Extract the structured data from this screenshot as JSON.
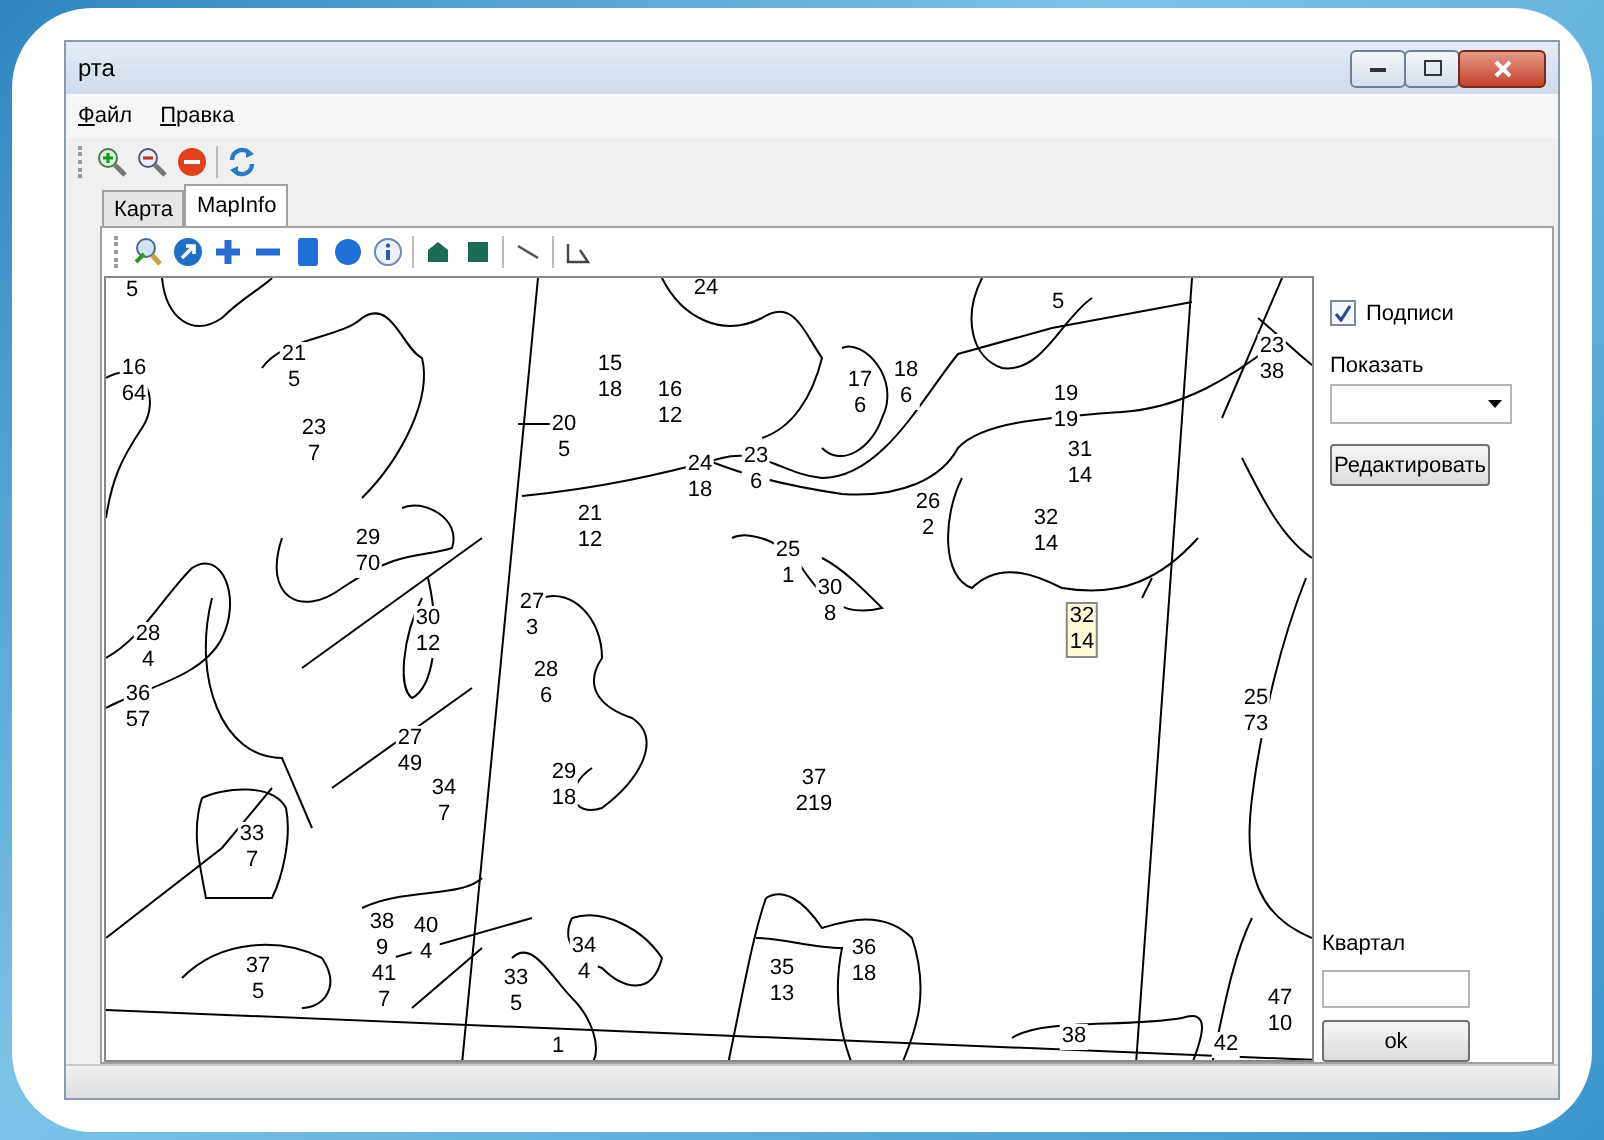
{
  "window": {
    "title": "рта"
  },
  "menu": [
    {
      "label": "Файл"
    },
    {
      "label": "Правка"
    }
  ],
  "tabs": [
    {
      "label": "Карта",
      "selected": false
    },
    {
      "label": "MapInfo",
      "selected": true
    }
  ],
  "map": {
    "labels": [
      {
        "line_1": "5"
      },
      {
        "line_1": "24"
      },
      {
        "line_1": "5"
      },
      {
        "line_1": "16",
        "line_2": "64"
      },
      {
        "line_1": "21",
        "line_2": "5"
      },
      {
        "line_1": "23",
        "line_2": "7"
      },
      {
        "line_1": "15",
        "line_2": "18"
      },
      {
        "line_1": "16",
        "line_2": "12"
      },
      {
        "line_1": "17",
        "line_2": "6"
      },
      {
        "line_1": "18",
        "line_2": "6"
      },
      {
        "line_1": "19",
        "line_2": "19"
      },
      {
        "line_1": "23",
        "line_2": "38"
      },
      {
        "line_1": "20",
        "line_2": "5"
      },
      {
        "line_1": "24",
        "line_2": "18"
      },
      {
        "line_1": "23",
        "line_2": "6"
      },
      {
        "line_1": "31",
        "line_2": "14"
      },
      {
        "line_1": "26",
        "line_2": "2"
      },
      {
        "line_1": "32",
        "line_2": "14"
      },
      {
        "line_1": "21",
        "line_2": "12"
      },
      {
        "line_1": "29",
        "line_2": "70"
      },
      {
        "line_1": "25",
        "line_2": "1"
      },
      {
        "line_1": "30",
        "line_2": "8"
      },
      {
        "line_1": "27",
        "line_2": "3"
      },
      {
        "line_1": "30",
        "line_2": "12"
      },
      {
        "line_1": "28",
        "line_2": "4"
      },
      {
        "line_1": "32",
        "line_2": "14",
        "highlighted": true
      },
      {
        "line_1": "28",
        "line_2": "6"
      },
      {
        "line_1": "36",
        "line_2": "57"
      },
      {
        "line_1": "25",
        "line_2": "73"
      },
      {
        "line_1": "27",
        "line_2": "49"
      },
      {
        "line_1": "34",
        "line_2": "7"
      },
      {
        "line_1": "29",
        "line_2": "18"
      },
      {
        "line_1": "37",
        "line_2": "219"
      },
      {
        "line_1": "33",
        "line_2": "7"
      },
      {
        "line_1": "37",
        "line_2": "5"
      },
      {
        "line_1": "38",
        "line_2": "9"
      },
      {
        "line_1": "40",
        "line_2": "4"
      },
      {
        "line_1": "41",
        "line_2": "7"
      },
      {
        "line_1": "34",
        "line_2": "4"
      },
      {
        "line_1": "33",
        "line_2": "5"
      },
      {
        "line_1": "35",
        "line_2": "13"
      },
      {
        "line_1": "36",
        "line_2": "18"
      },
      {
        "line_1": "47",
        "line_2": "10"
      },
      {
        "line_1": "1"
      },
      {
        "line_1": "38"
      },
      {
        "line_1": "42"
      }
    ]
  },
  "panel": {
    "labels_checkbox": {
      "label": "Подписи",
      "checked": true
    },
    "show": {
      "label": "Показать"
    },
    "edit_button": "Редактировать",
    "quarter": {
      "label": "Квартал"
    },
    "ok_button": "ok"
  }
}
